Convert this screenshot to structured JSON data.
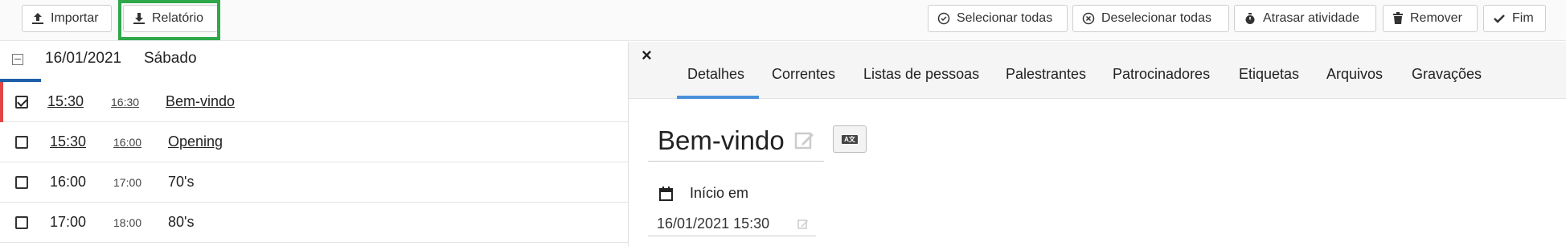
{
  "toolbar": {
    "import_label": "Importar",
    "report_label": "Relatório",
    "select_all_label": "Selecionar todas",
    "deselect_all_label": "Deselecionar todas",
    "delay_label": "Atrasar atividade",
    "remove_label": "Remover",
    "end_label": "Fim"
  },
  "schedule": {
    "date": "16/01/2021",
    "weekday": "Sábado",
    "rows": [
      {
        "start": "15:30",
        "end": "16:30",
        "name": "Bem-vindo",
        "checked": true
      },
      {
        "start": "15:30",
        "end": "16:00",
        "name": "Opening",
        "checked": false
      },
      {
        "start": "16:00",
        "end": "17:00",
        "name": "70's",
        "checked": false
      },
      {
        "start": "17:00",
        "end": "18:00",
        "name": "80's",
        "checked": false
      }
    ]
  },
  "details": {
    "close_label": "×",
    "tabs": [
      "Detalhes",
      "Correntes",
      "Listas de pessoas",
      "Palestrantes",
      "Patrocinadores",
      "Etiquetas",
      "Arquivos",
      "Gravações"
    ],
    "title": "Bem-vindo",
    "start_label": "Início em",
    "start_value": "16/01/2021 15:30"
  },
  "colors": {
    "highlight": "#2ea84a",
    "active_tab": "#4a90d9",
    "selected_marker": "#e04646"
  }
}
